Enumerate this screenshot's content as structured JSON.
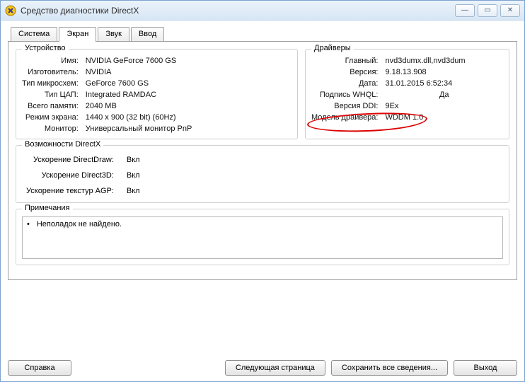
{
  "window": {
    "title": "Средство диагностики DirectX",
    "controls": {
      "minimize": "—",
      "maximize": "▭",
      "close": "✕"
    }
  },
  "tabs": {
    "system": "Система",
    "screen": "Экран",
    "sound": "Звук",
    "input": "Ввод"
  },
  "device": {
    "legend": "Устройство",
    "name_label": "Имя:",
    "name_value": "NVIDIA GeForce 7600 GS",
    "manufacturer_label": "Изготовитель:",
    "manufacturer_value": "NVIDIA",
    "chip_label": "Тип микросхем:",
    "chip_value": "GeForce 7600 GS",
    "dac_label": "Тип ЦАП:",
    "dac_value": "Integrated RAMDAC",
    "memory_label": "Всего памяти:",
    "memory_value": "2040 MB",
    "mode_label": "Режим экрана:",
    "mode_value": "1440 x 900 (32 bit) (60Hz)",
    "monitor_label": "Монитор:",
    "monitor_value": "Универсальный монитор PnP"
  },
  "drivers": {
    "legend": "Драйверы",
    "main_label": "Главный:",
    "main_value": "nvd3dumx.dll,nvd3dum",
    "version_label": "Версия:",
    "version_value": "9.18.13.908",
    "date_label": "Дата:",
    "date_value": "31.01.2015 6:52:34",
    "whql_label": "Подпись WHQL:",
    "whql_value": "Да",
    "ddi_label": "Версия DDI:",
    "ddi_value": "9Ex",
    "model_label": "Модель драйвера:",
    "model_value": "WDDM 1.0"
  },
  "dx": {
    "legend": "Возможности DirectX",
    "ddraw_label": "Ускорение DirectDraw:",
    "d3d_label": "Ускорение Direct3D:",
    "agp_label": "Ускорение текстур AGP:",
    "enabled": "Вкл"
  },
  "notes": {
    "legend": "Примечания",
    "item": "Неполадок не найдено."
  },
  "footer": {
    "help": "Справка",
    "next": "Следующая страница",
    "save": "Сохранить все сведения...",
    "exit": "Выход"
  }
}
